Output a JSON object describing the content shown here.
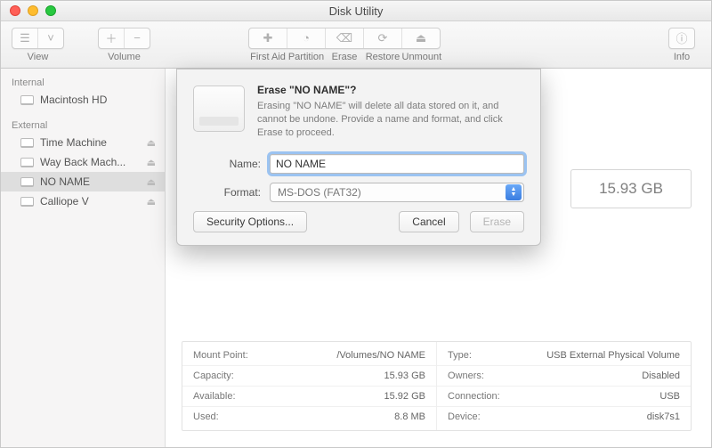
{
  "window": {
    "title": "Disk Utility"
  },
  "toolbar": {
    "view": "View",
    "volume": "Volume",
    "first_aid": "First Aid",
    "partition": "Partition",
    "erase": "Erase",
    "restore": "Restore",
    "unmount": "Unmount",
    "info": "Info"
  },
  "sidebar": {
    "internal_header": "Internal",
    "external_header": "External",
    "internal": [
      {
        "label": "Macintosh HD"
      }
    ],
    "external": [
      {
        "label": "Time Machine"
      },
      {
        "label": "Way Back Mach..."
      },
      {
        "label": "NO NAME"
      },
      {
        "label": "Calliope V"
      }
    ]
  },
  "capacity": "15.93 GB",
  "details": {
    "left": [
      {
        "k": "Mount Point:",
        "v": "/Volumes/NO NAME"
      },
      {
        "k": "Capacity:",
        "v": "15.93 GB"
      },
      {
        "k": "Available:",
        "v": "15.92 GB"
      },
      {
        "k": "Used:",
        "v": "8.8 MB"
      }
    ],
    "right": [
      {
        "k": "Type:",
        "v": "USB External Physical Volume"
      },
      {
        "k": "Owners:",
        "v": "Disabled"
      },
      {
        "k": "Connection:",
        "v": "USB"
      },
      {
        "k": "Device:",
        "v": "disk7s1"
      }
    ]
  },
  "sheet": {
    "title": "Erase \"NO NAME\"?",
    "desc": "Erasing \"NO NAME\" will delete all data stored on it, and cannot be undone. Provide a name and format, and click Erase to proceed.",
    "name_label": "Name:",
    "name_value": "NO NAME",
    "format_label": "Format:",
    "format_value": "MS-DOS (FAT32)",
    "security": "Security Options...",
    "cancel": "Cancel",
    "erase": "Erase"
  }
}
